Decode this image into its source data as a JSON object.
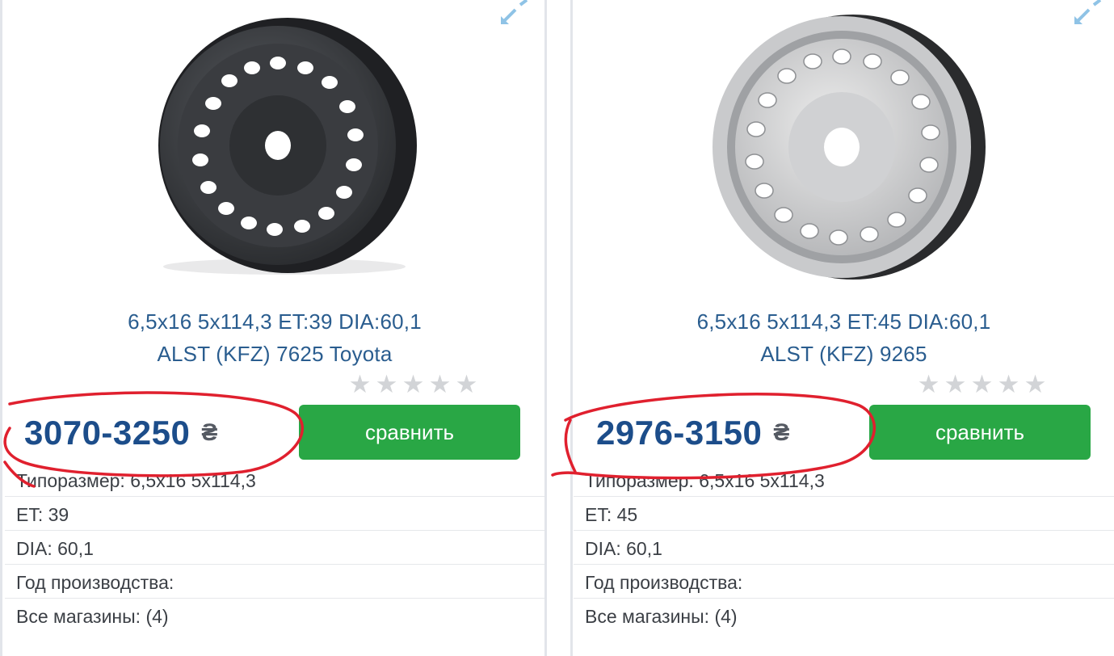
{
  "products": [
    {
      "image": "steel-wheel-black",
      "title_line1": "6,5x16 5x114,3 ET:39 DIA:60,1",
      "title_line2": "ALST (KFZ) 7625 Toyota",
      "rating_stars": 0,
      "rating_max": 5,
      "price": "3070-3250",
      "currency": "₴",
      "compare_label": "сравнить",
      "specs": [
        {
          "label": "Типоразмер:",
          "value": "6,5x16 5x114,3"
        },
        {
          "label": "ET:",
          "value": "39"
        },
        {
          "label": "DIA:",
          "value": "60,1"
        },
        {
          "label": "Год производства:",
          "value": ""
        },
        {
          "label": "Все магазины:",
          "value": "(4)"
        }
      ]
    },
    {
      "image": "steel-wheel-silver",
      "title_line1": "6,5x16 5x114,3 ET:45 DIA:60,1",
      "title_line2": "ALST (KFZ) 9265",
      "rating_stars": 0,
      "rating_max": 5,
      "price": "2976-3150",
      "currency": "₴",
      "compare_label": "сравнить",
      "specs": [
        {
          "label": "Типоразмер:",
          "value": "6,5x16 5x114,3"
        },
        {
          "label": "ET:",
          "value": "45"
        },
        {
          "label": "DIA:",
          "value": "60,1"
        },
        {
          "label": "Год производства:",
          "value": ""
        },
        {
          "label": "Все магазины:",
          "value": "(4)"
        }
      ]
    }
  ],
  "colors": {
    "title": "#2a5d8f",
    "price": "#1c4d8a",
    "button": "#29a745",
    "star_empty": "#d2d4d7",
    "annotation": "#e0202e"
  },
  "icons": {
    "expand": "expand-arrows-icon",
    "star": "star-icon"
  }
}
